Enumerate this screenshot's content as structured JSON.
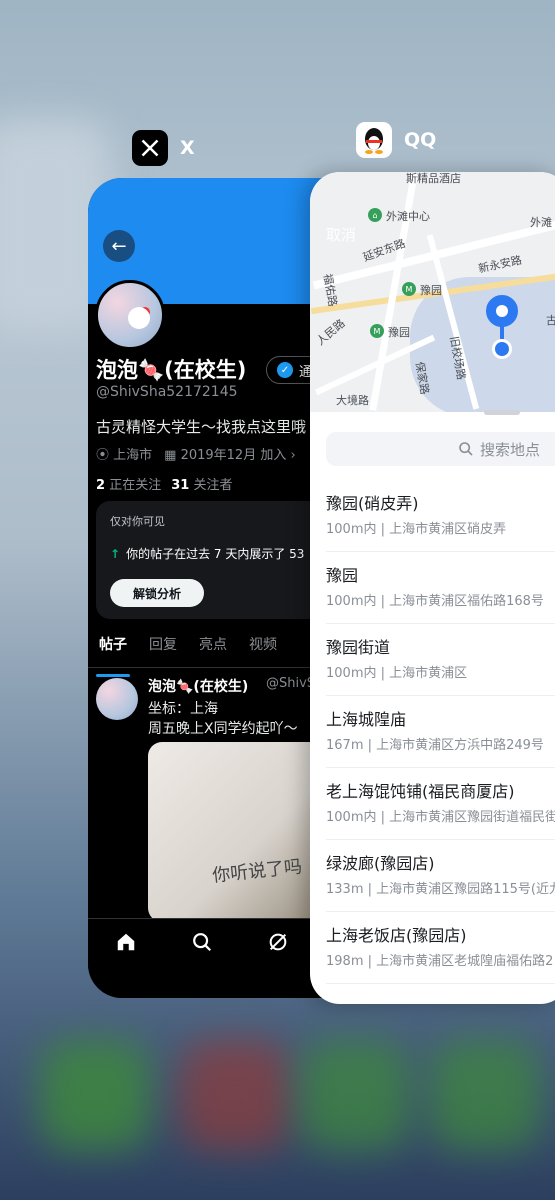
{
  "switcher": {
    "apps": [
      {
        "name": "X",
        "icon": "x-logo-icon"
      },
      {
        "name": "QQ",
        "icon": "qq-penguin-icon"
      }
    ]
  },
  "x_app": {
    "profile": {
      "name": "泡泡🍬(在校生)",
      "handle": "@ShivSha52172145",
      "verified_label": "通",
      "bio": "古灵精怪大学生～找我点这里哦",
      "location": "上海市",
      "joined": "2019年12月 加入",
      "following_count": "2",
      "following_label": "正在关注",
      "followers_count": "31",
      "followers_label": "关注者"
    },
    "insight": {
      "visibility": "仅对你可见",
      "message": "你的帖子在过去 7 天内展示了 53",
      "button": "解锁分析"
    },
    "tabs": [
      "帖子",
      "回复",
      "亮点",
      "视频"
    ],
    "post": {
      "name": "泡泡🍬(在校生)",
      "handle": "@ShivS",
      "line1": "坐标：上海",
      "line2": "周五晚上X同学约起吖～",
      "image_text": "你听说了吗"
    },
    "nav": [
      "home-icon",
      "search-icon",
      "grok-icon",
      "people-icon",
      "bell-icon"
    ]
  },
  "qq_app": {
    "map": {
      "cancel": "取消",
      "labels": [
        "斯精品酒店",
        "外滩中心",
        "外滩",
        "延安东路",
        "新永安路",
        "豫园",
        "豫园",
        "古",
        "福佑路",
        "人民路",
        "旧校场路",
        "保家路",
        "大境路"
      ]
    },
    "search_placeholder": "搜索地点",
    "results": [
      {
        "name": "豫园(硝皮弄)",
        "addr": "100m内 | 上海市黄浦区硝皮弄"
      },
      {
        "name": "豫园",
        "addr": "100m内 | 上海市黄浦区福佑路168号"
      },
      {
        "name": "豫园街道",
        "addr": "100m内 | 上海市黄浦区"
      },
      {
        "name": "上海城隍庙",
        "addr": "167m | 上海市黄浦区方浜中路249号"
      },
      {
        "name": "老上海馄饨铺(福民商厦店)",
        "addr": "100m内 | 上海市黄浦区豫园街道福民街"
      },
      {
        "name": "绿波廊(豫园店)",
        "addr": "133m | 上海市黄浦区豫园路115号(近九"
      },
      {
        "name": "上海老饭店(豫园店)",
        "addr": "198m | 上海市黄浦区老城隍庙福佑路2"
      }
    ]
  },
  "colors": {
    "x_blue": "#1d9bf0",
    "qq_blue": "#2d79f1",
    "metro_green": "#36a05b"
  }
}
